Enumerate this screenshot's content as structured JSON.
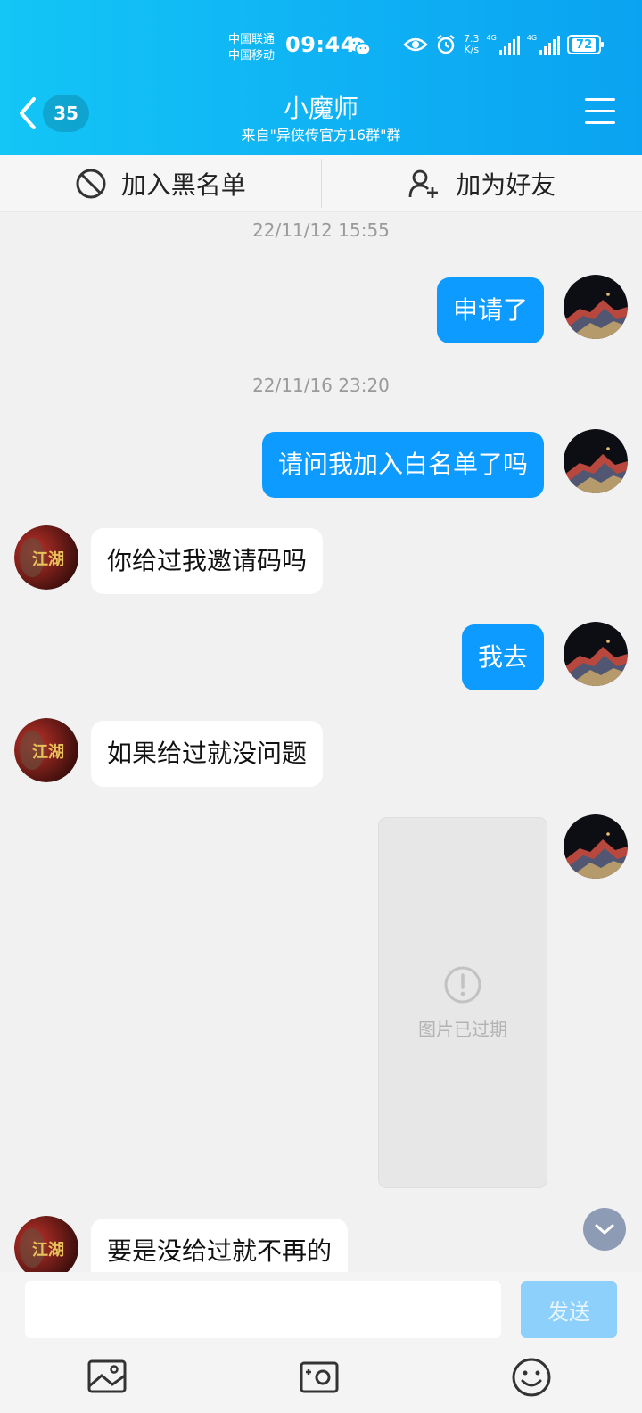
{
  "status_bar": {
    "carrier1": "中国联通",
    "carrier2": "中国移动",
    "time": "09:44",
    "net_speed_value": "7.3",
    "net_speed_unit": "K/s",
    "signal1_label": "4G",
    "signal2_label": "4G",
    "battery": "72"
  },
  "header": {
    "back_count": "35",
    "title": "小魔师",
    "subtitle": "来自\"异侠传官方16群\"群"
  },
  "actions": {
    "blacklist": "加入黑名单",
    "add_friend": "加为好友"
  },
  "chat": {
    "timestamps": [
      "22/11/12 15:55",
      "22/11/16 23:20"
    ],
    "messages": [
      {
        "side": "out",
        "text": "申请了"
      },
      {
        "side": "out",
        "text": "请问我加入白名单了吗"
      },
      {
        "side": "in",
        "text": "你给过我邀请码吗"
      },
      {
        "side": "out",
        "text": "我去"
      },
      {
        "side": "in",
        "text": "如果给过就没问题"
      },
      {
        "side": "in",
        "text": "要是没给过就不再的"
      }
    ],
    "expired_image_text": "图片已过期",
    "avatar_text": "江湖"
  },
  "input": {
    "placeholder": "",
    "send_label": "发送"
  },
  "colors": {
    "header": "#0fb1f4",
    "outgoing_bubble": "#0e9bff",
    "incoming_bubble": "#ffffff",
    "send_disabled": "#8dd0fb",
    "background": "#f1f1f1"
  },
  "icons": [
    "back-chevron-icon",
    "wechat-icon",
    "eye-icon",
    "alarm-icon",
    "signal-icon",
    "battery-icon",
    "menu-icon",
    "block-icon",
    "add-user-icon",
    "warning-icon",
    "chevron-down-icon",
    "image-icon",
    "camera-icon",
    "emoji-icon"
  ]
}
